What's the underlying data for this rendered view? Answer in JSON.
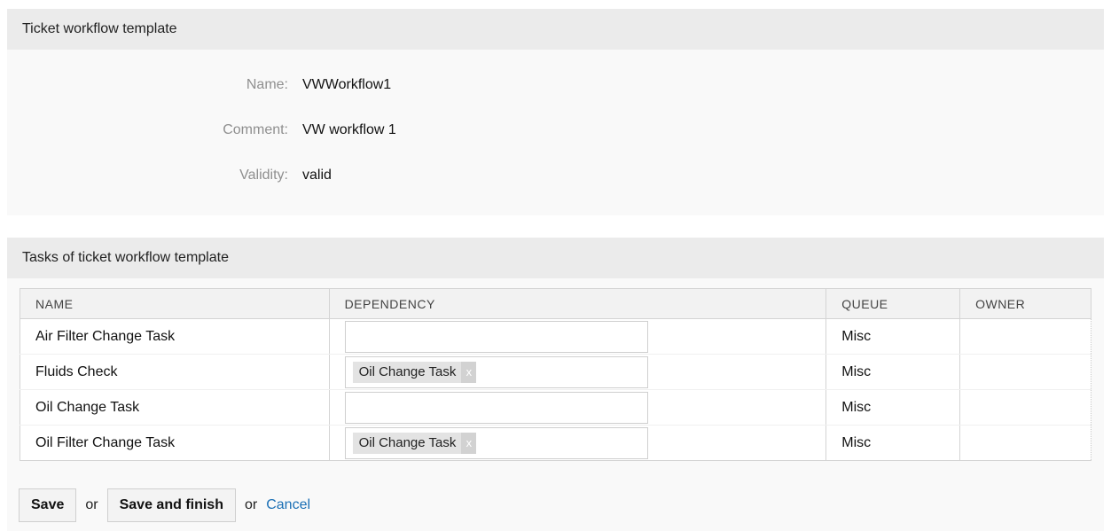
{
  "template_widget": {
    "title": "Ticket workflow template",
    "fields": [
      {
        "label": "Name:",
        "value": "VWWorkflow1"
      },
      {
        "label": "Comment:",
        "value": "VW workflow 1"
      },
      {
        "label": "Validity:",
        "value": "valid"
      }
    ]
  },
  "tasks_widget": {
    "title": "Tasks of ticket workflow template",
    "columns": [
      "NAME",
      "DEPENDENCY",
      "QUEUE",
      "OWNER"
    ],
    "rows": [
      {
        "name": "Air Filter Change Task",
        "dependency": "",
        "queue": "Misc",
        "owner": ""
      },
      {
        "name": "Fluids Check",
        "dependency": "Oil Change Task",
        "queue": "Misc",
        "owner": ""
      },
      {
        "name": "Oil Change Task",
        "dependency": "",
        "queue": "Misc",
        "owner": ""
      },
      {
        "name": "Oil Filter Change Task",
        "dependency": "Oil Change Task",
        "queue": "Misc",
        "owner": ""
      }
    ],
    "tag_remove_label": "x"
  },
  "actions": {
    "save_label": "Save",
    "or_label": "or",
    "save_finish_label": "Save and finish",
    "cancel_label": "Cancel"
  },
  "colors": {
    "header_bg": "#ebebeb",
    "panel_bg": "#f9f9f9",
    "link": "#1a6fb5"
  }
}
